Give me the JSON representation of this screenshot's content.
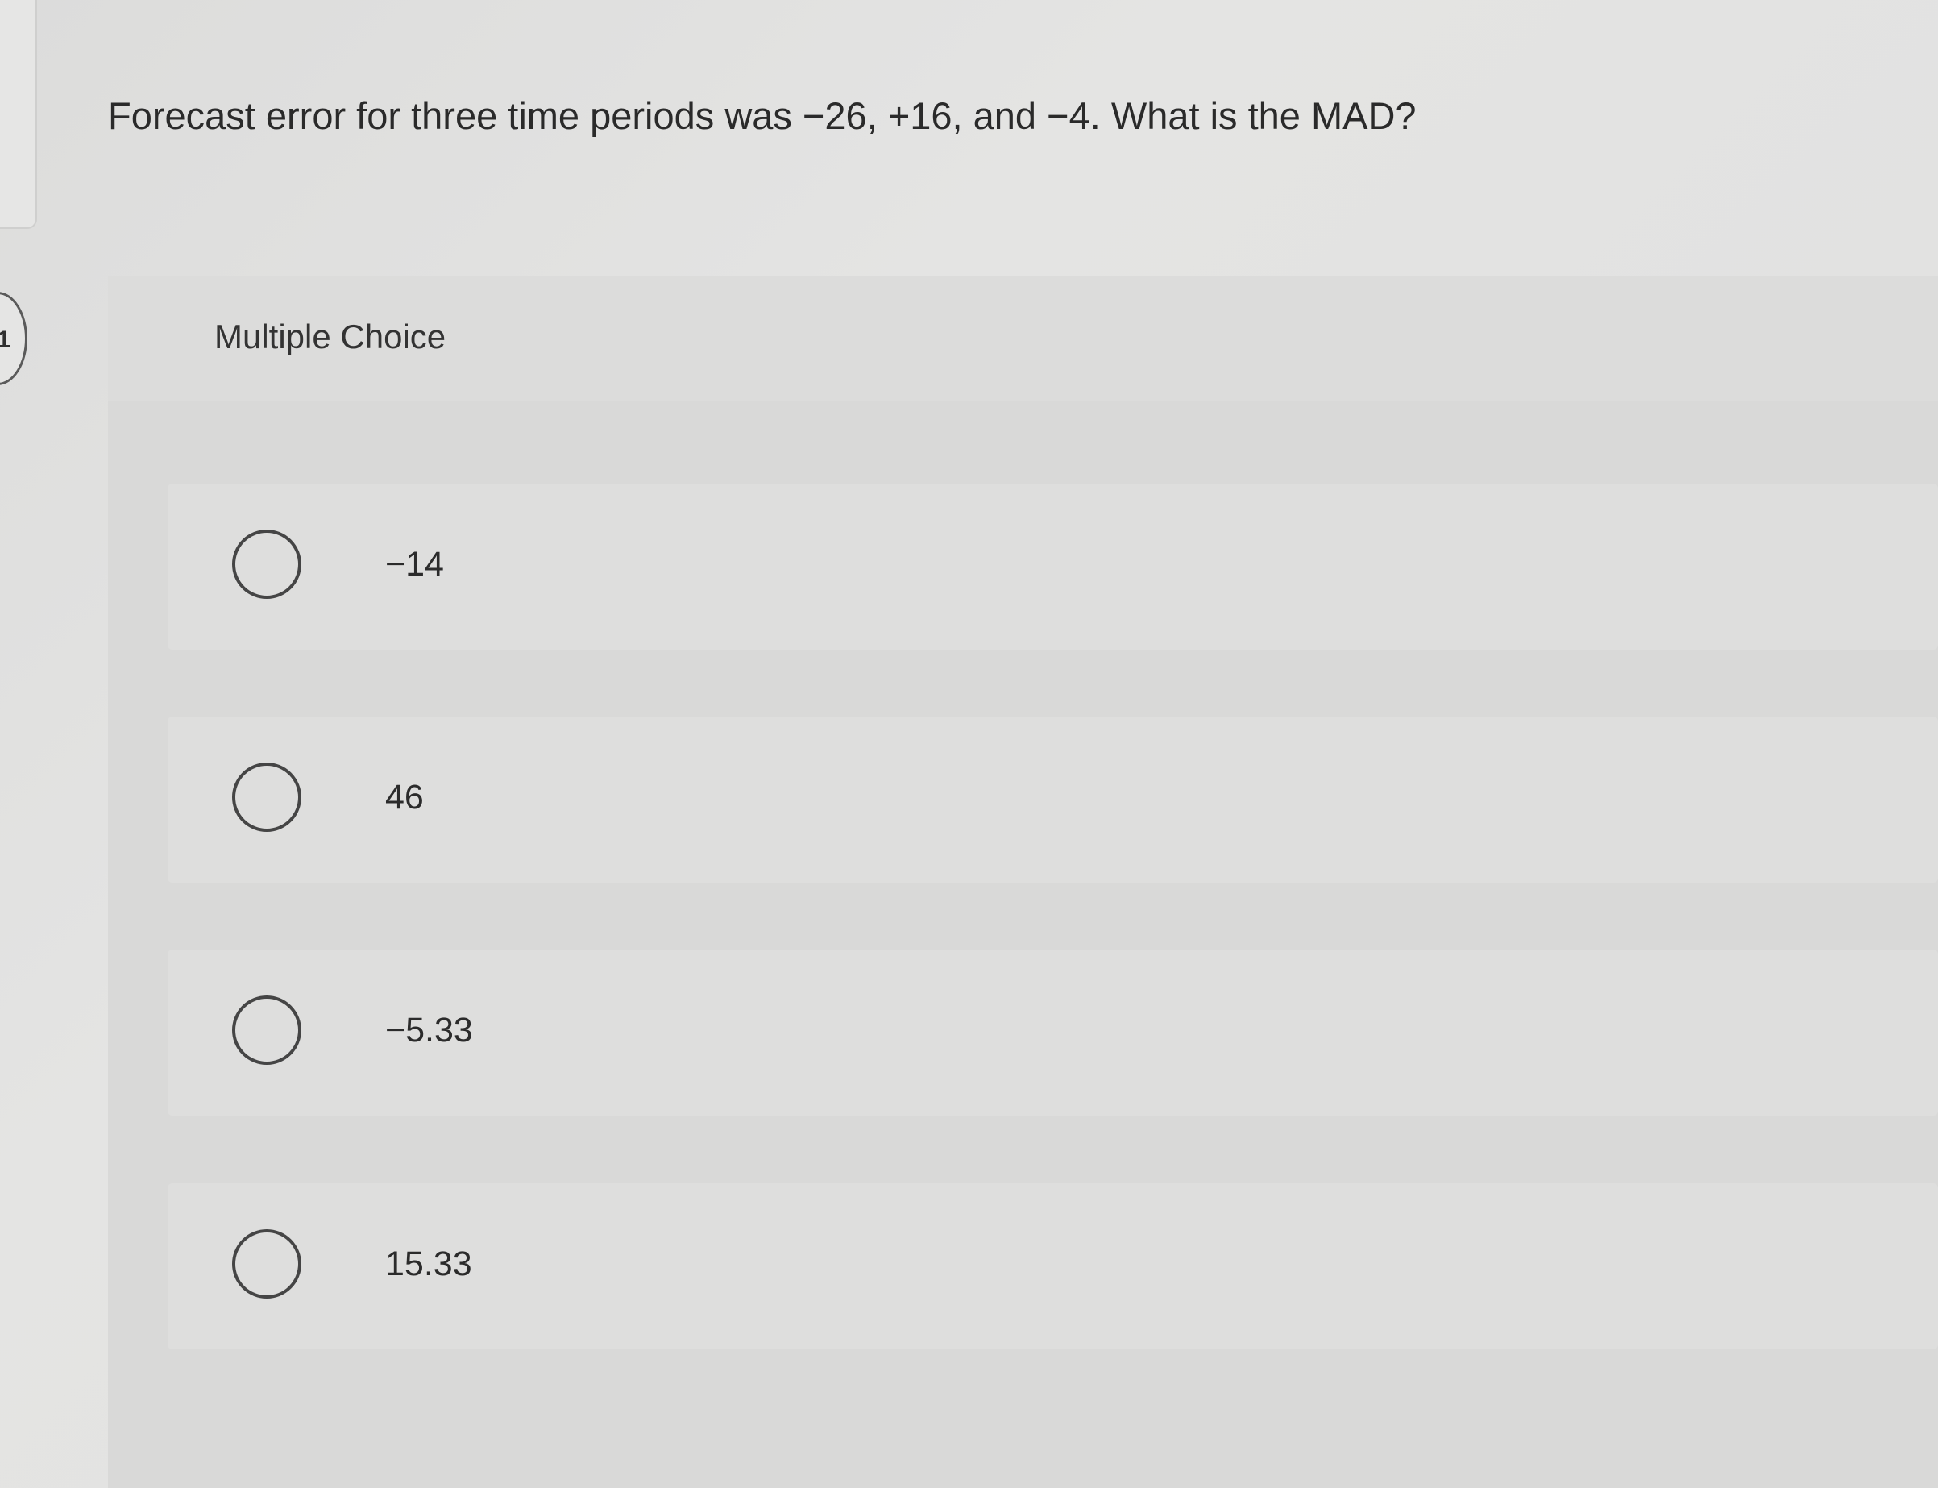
{
  "question": {
    "number": "1",
    "text": "Forecast error for three time periods was −26, +16, and −4. What is the MAD?"
  },
  "choice_block": {
    "label": "Multiple Choice",
    "options": [
      {
        "label": "−14",
        "selected": false
      },
      {
        "label": "46",
        "selected": false
      },
      {
        "label": "−5.33",
        "selected": false
      },
      {
        "label": "15.33",
        "selected": false
      }
    ]
  }
}
